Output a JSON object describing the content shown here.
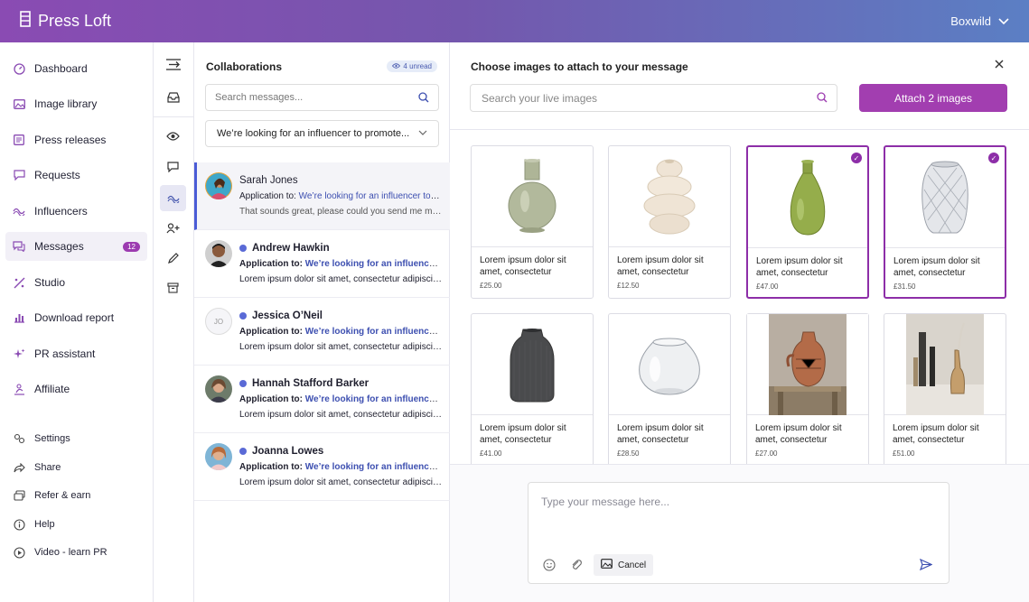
{
  "app": {
    "brand": "Press Loft",
    "account": "Boxwild"
  },
  "nav": {
    "items": [
      {
        "label": "Dashboard",
        "icon": "dashboard-icon"
      },
      {
        "label": "Image library",
        "icon": "image-icon"
      },
      {
        "label": "Press releases",
        "icon": "press-icon"
      },
      {
        "label": "Requests",
        "icon": "chat-icon"
      },
      {
        "label": "Influencers",
        "icon": "influencer-icon"
      },
      {
        "label": "Messages",
        "icon": "messages-icon",
        "badge": "12"
      },
      {
        "label": "Studio",
        "icon": "studio-icon"
      },
      {
        "label": "Download report",
        "icon": "report-icon"
      },
      {
        "label": "PR assistant",
        "icon": "sparkle-icon"
      },
      {
        "label": "Affiliate",
        "icon": "affiliate-icon"
      }
    ],
    "secondary": [
      {
        "label": "Settings"
      },
      {
        "label": "Share"
      },
      {
        "label": "Refer & earn"
      },
      {
        "label": "Help"
      },
      {
        "label": "Video - learn PR"
      }
    ]
  },
  "messages": {
    "title": "Collaborations",
    "unread": "4 unread",
    "search_placeholder": "Search messages...",
    "filter": "We’re looking for an influencer to promote...",
    "conversations": [
      {
        "name": "Sarah Jones",
        "app_label": "Application to:",
        "app_link": "We’re looking for an influencer to promote",
        "preview": "That sounds great, please could you send me more details"
      },
      {
        "name": "Andrew Hawkin",
        "app_label": "Application to:",
        "app_link": "We’re looking for an influencer to promote",
        "preview": "Lorem ipsum dolor sit amet, consectetur adipiscing elit"
      },
      {
        "name": "Jessica O’Neil",
        "initials": "JO",
        "app_label": "Application to:",
        "app_link": "We’re looking for an influencer to promote",
        "preview": "Lorem ipsum dolor sit amet, consectetur adipiscing elit"
      },
      {
        "name": "Hannah Stafford Barker",
        "app_label": "Application to:",
        "app_link": "We’re looking for an influencer to promote",
        "preview": "Lorem ipsum dolor sit amet, consectetur adipiscing elit"
      },
      {
        "name": "Joanna Lowes",
        "app_label": "Application to:",
        "app_link": "We’re looking for an influencer to promote",
        "preview": "Lorem ipsum dolor sit amet, consectetur adipiscing elit"
      }
    ]
  },
  "panel": {
    "title": "Choose images to attach to your message",
    "search_placeholder": "Search your live images",
    "attach_label": "Attach 2 images",
    "images": [
      {
        "desc": "Lorem ipsum dolor sit amet, consectetur adipiscing",
        "price": "£25.00",
        "selected": false
      },
      {
        "desc": "Lorem ipsum dolor sit amet, consectetur adipiscing",
        "price": "£12.50",
        "selected": false
      },
      {
        "desc": "Lorem ipsum dolor sit amet, consectetur adipiscing",
        "price": "£47.00",
        "selected": true
      },
      {
        "desc": "Lorem ipsum dolor sit amet, consectetur adipiscing",
        "price": "£31.50",
        "selected": true
      },
      {
        "desc": "Lorem ipsum dolor sit amet, consectetur adipiscing",
        "price": "£41.00",
        "selected": false
      },
      {
        "desc": "Lorem ipsum dolor sit amet, consectetur adipiscing",
        "price": "£28.50",
        "selected": false
      },
      {
        "desc": "Lorem ipsum dolor sit amet, consectetur adipiscing",
        "price": "£27.00",
        "selected": false
      },
      {
        "desc": "Lorem ipsum dolor sit amet, consectetur adipiscing",
        "price": "£51.00",
        "selected": false
      }
    ]
  },
  "composer": {
    "placeholder": "Type your message here...",
    "cancel_label": "Cancel"
  },
  "colors": {
    "accent": "#a23eb0",
    "link": "#3d4fb0",
    "unread_dot": "#5a6ad6"
  }
}
